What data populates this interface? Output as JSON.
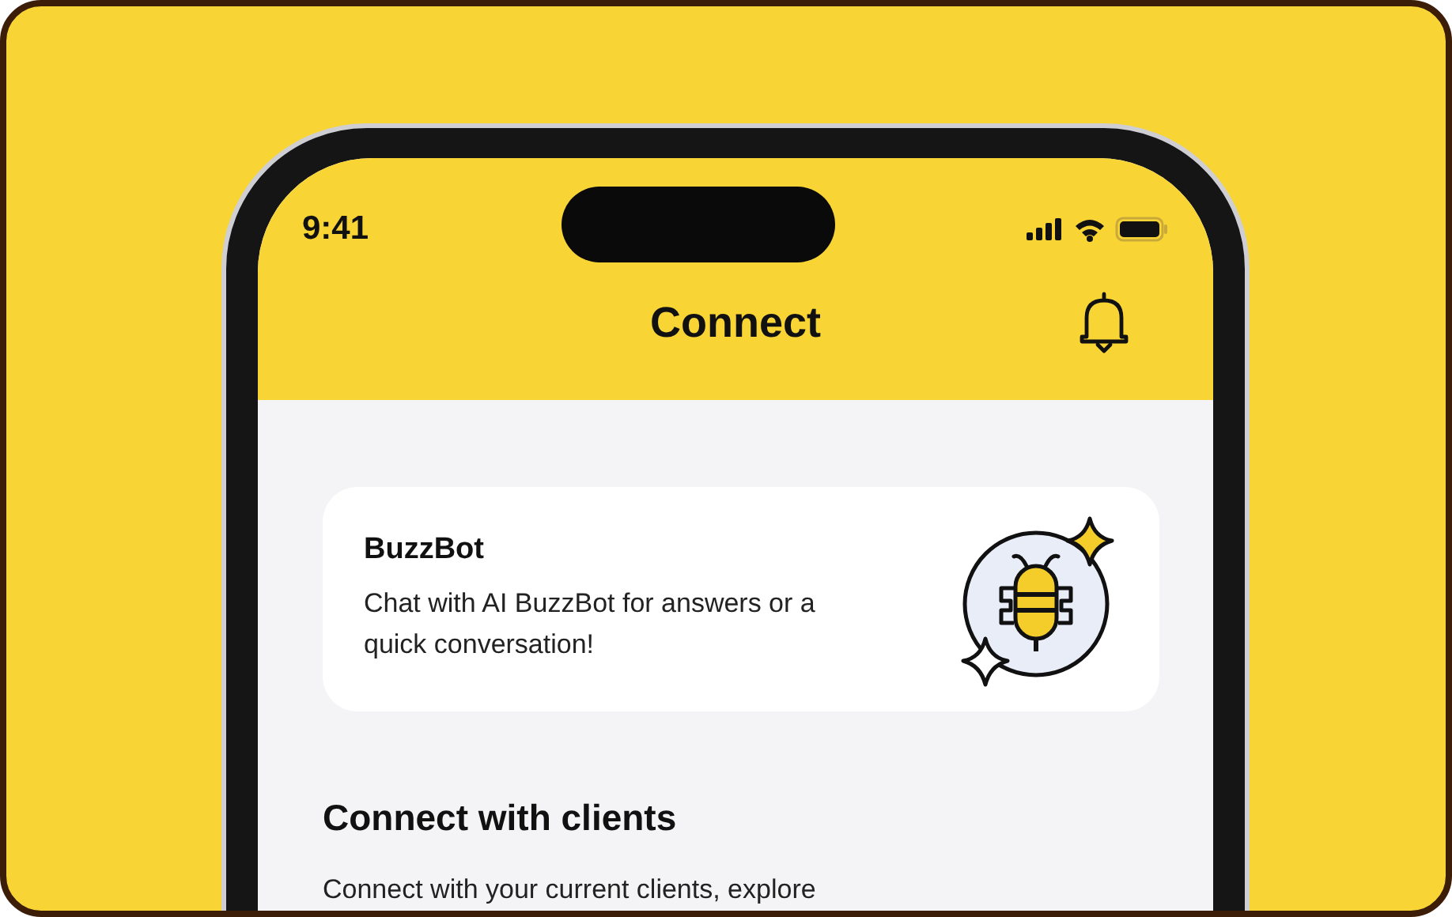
{
  "status_bar": {
    "time": "9:41"
  },
  "header": {
    "title": "Connect"
  },
  "bot_card": {
    "title": "BuzzBot",
    "text": "Chat with AI BuzzBot for answers or a quick conversation!"
  },
  "section": {
    "heading": "Connect with clients",
    "text": "Connect with your current clients, explore"
  }
}
